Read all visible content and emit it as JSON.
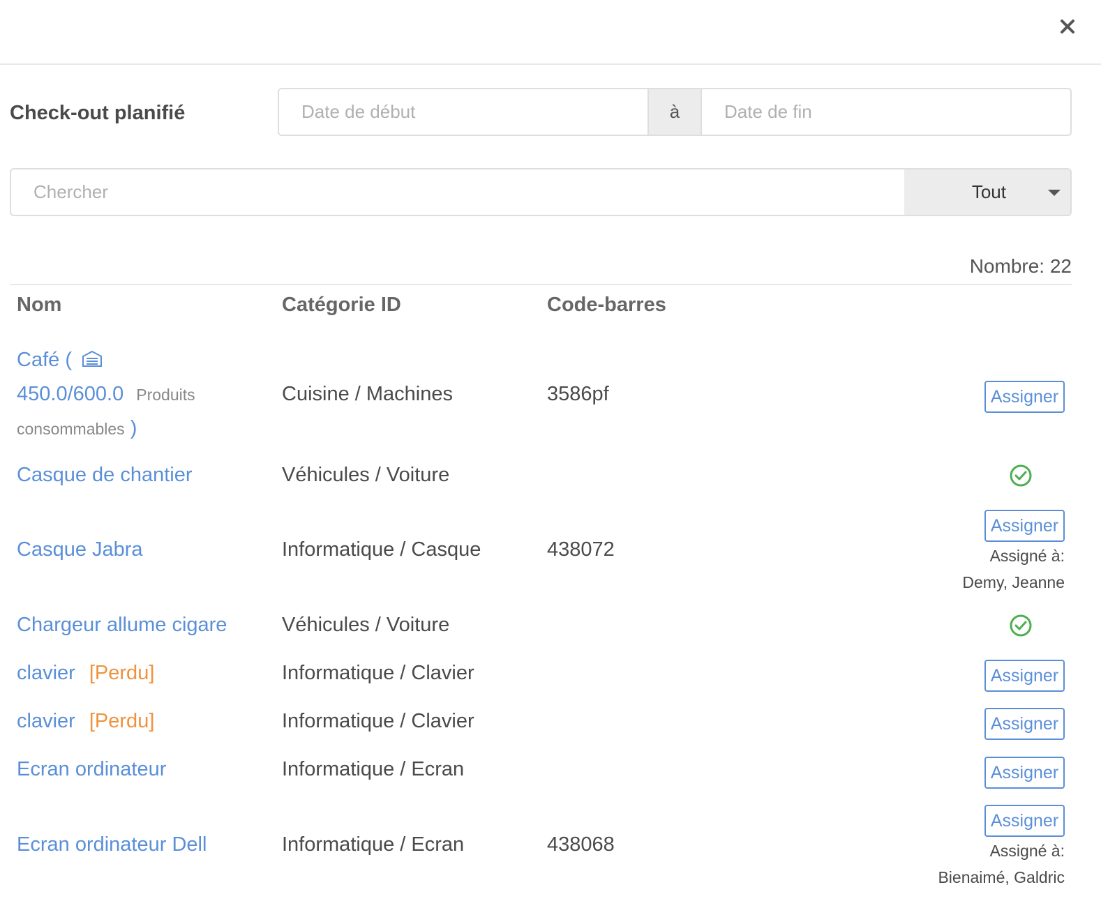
{
  "header": {
    "close_icon": "close-icon"
  },
  "filters": {
    "checkout_label": "Check-out planifié",
    "start_placeholder": "Date de début",
    "separator": "à",
    "end_placeholder": "Date de fin"
  },
  "search": {
    "placeholder": "Chercher",
    "filter_value": "Tout"
  },
  "count_text": "Nombre: 22",
  "table": {
    "columns": [
      "Nom",
      "Catégorie ID",
      "Code-barres"
    ],
    "rows": [
      {
        "name": "Café (",
        "stock": "450.0/600.0",
        "stock_label_1": "Produits",
        "stock_label_2": "consommables",
        "stock_close": ")",
        "category": "Cuisine / Machines",
        "barcode": "3586pf",
        "action": "Assigner"
      },
      {
        "name": "Casque de chantier",
        "category": "Véhicules / Voiture",
        "barcode": "",
        "status_icon": "check-circle-icon"
      },
      {
        "name": "Casque Jabra",
        "category": "Informatique / Casque",
        "barcode": "438072",
        "action": "Assigner",
        "assigned_label": "Assigné à:",
        "assigned_to": "Demy, Jeanne"
      },
      {
        "name": "Chargeur allume cigare",
        "category": "Véhicules / Voiture",
        "barcode": "",
        "status_icon": "check-circle-icon"
      },
      {
        "name": "clavier",
        "tag": "[Perdu]",
        "category": "Informatique / Clavier",
        "barcode": "",
        "action": "Assigner"
      },
      {
        "name": "clavier",
        "tag": "[Perdu]",
        "category": "Informatique / Clavier",
        "barcode": "",
        "action": "Assigner"
      },
      {
        "name": "Ecran ordinateur",
        "category": "Informatique / Ecran",
        "barcode": "",
        "action": "Assigner"
      },
      {
        "name": "Ecran ordinateur Dell",
        "category": "Informatique / Ecran",
        "barcode": "438068",
        "action": "Assigner",
        "assigned_label": "Assigné à:",
        "assigned_to": "Bienaimé, Galdric"
      }
    ]
  },
  "colors": {
    "link": "#5a8fd8",
    "lost": "#f0923c",
    "success": "#4caf50"
  }
}
